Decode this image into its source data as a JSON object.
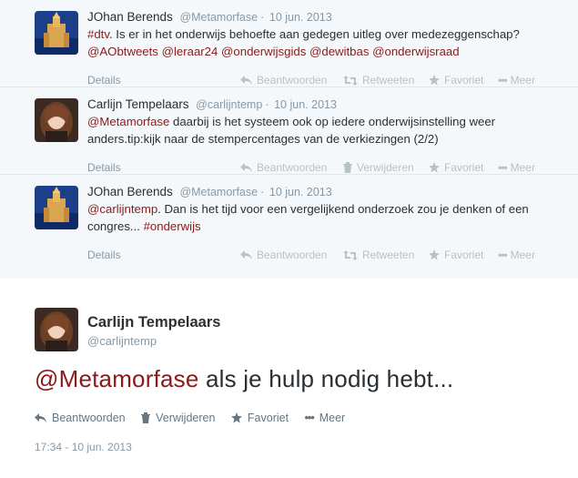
{
  "thread": [
    {
      "name": "JOhan Berends",
      "handle": "@Metamorfase",
      "date": "10 jun. 2013",
      "text_parts": [
        {
          "t": "#dtv",
          "link": true
        },
        {
          "t": ". Is er in het onderwijs behoefte aan gedegen uitleg over medezeggenschap? ",
          "link": false
        },
        {
          "t": "@AObtweets",
          "link": true
        },
        {
          "t": " ",
          "link": false
        },
        {
          "t": "@leraar24",
          "link": true
        },
        {
          "t": " ",
          "link": false
        },
        {
          "t": "@onderwijsgids",
          "link": true
        },
        {
          "t": " ",
          "link": false
        },
        {
          "t": "@dewitbas",
          "link": true
        },
        {
          "t": " ",
          "link": false
        },
        {
          "t": "@onderwijsraad",
          "link": true
        }
      ],
      "details": "Details",
      "actions": [
        "Beantwoorden",
        "Retweeten",
        "Favoriet",
        "Meer"
      ]
    },
    {
      "name": "Carlijn Tempelaars",
      "handle": "@carlijntemp",
      "date": "10 jun. 2013",
      "text_parts": [
        {
          "t": "@Metamorfase",
          "link": true
        },
        {
          "t": " daarbij is het systeem ook op iedere onderwijsinstelling weer anders.tip:kijk naar de stempercentages van de verkiezingen (2/2)",
          "link": false
        }
      ],
      "details": "Details",
      "actions": [
        "Beantwoorden",
        "Verwijderen",
        "Favoriet",
        "Meer"
      ]
    },
    {
      "name": "JOhan Berends",
      "handle": "@Metamorfase",
      "date": "10 jun. 2013",
      "text_parts": [
        {
          "t": "@carlijntemp",
          "link": true
        },
        {
          "t": ". Dan is het tijd voor een vergelijkend onderzoek zou je denken of een congres... ",
          "link": false
        },
        {
          "t": "#onderwijs",
          "link": true
        }
      ],
      "details": "Details",
      "actions": [
        "Beantwoorden",
        "Retweeten",
        "Favoriet",
        "Meer"
      ]
    }
  ],
  "main": {
    "name": "Carlijn Tempelaars",
    "handle": "@carlijntemp",
    "mention": "@Metamorfase",
    "text": " als je hulp nodig hebt...",
    "actions": [
      "Beantwoorden",
      "Verwijderen",
      "Favoriet",
      "Meer"
    ],
    "timestamp": "17:34 - 10 jun. 2013"
  },
  "colors": {
    "link": "#8b1a1a",
    "background": "#f5f8fa"
  }
}
